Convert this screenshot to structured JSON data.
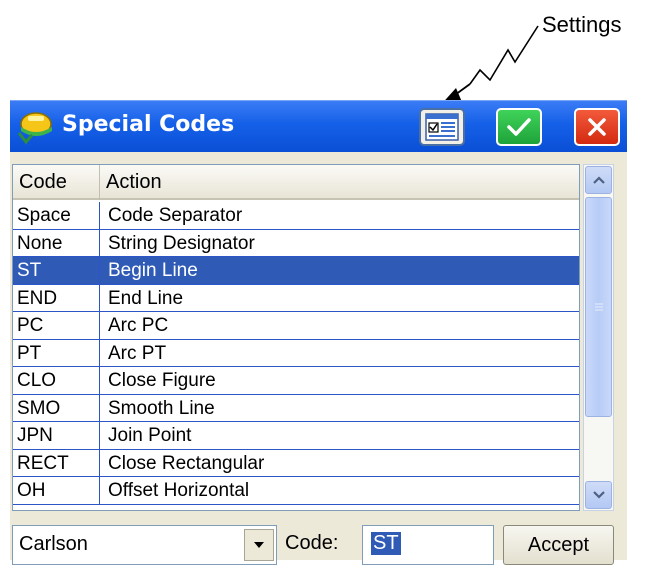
{
  "callout": {
    "label": "Settings"
  },
  "window": {
    "title": "Special Codes",
    "buttons": {
      "settings_icon": "settings-grid-icon",
      "ok_icon": "checkmark-icon",
      "close_icon": "close-icon"
    },
    "colors": {
      "titlebar": "#1560e8",
      "selection": "#2f5bb7",
      "ok": "#2bbf47",
      "close": "#e0401f"
    }
  },
  "table": {
    "headers": {
      "code": "Code",
      "action": "Action"
    },
    "rows": [
      {
        "code": "Space",
        "action": "Code Separator"
      },
      {
        "code": "None",
        "action": "String Designator"
      },
      {
        "code": "ST",
        "action": "Begin Line",
        "selected": true
      },
      {
        "code": "END",
        "action": "End Line"
      },
      {
        "code": "PC",
        "action": "Arc PC"
      },
      {
        "code": "PT",
        "action": "Arc PT"
      },
      {
        "code": "CLO",
        "action": "Close Figure"
      },
      {
        "code": "SMO",
        "action": "Smooth Line"
      },
      {
        "code": "JPN",
        "action": "Join Point"
      },
      {
        "code": "RECT",
        "action": "Close Rectangular"
      },
      {
        "code": "OH",
        "action": "Offset Horizontal"
      }
    ]
  },
  "bottom": {
    "preset_value": "Carlson",
    "code_label": "Code:",
    "code_value": "ST",
    "accept_label": "Accept"
  }
}
